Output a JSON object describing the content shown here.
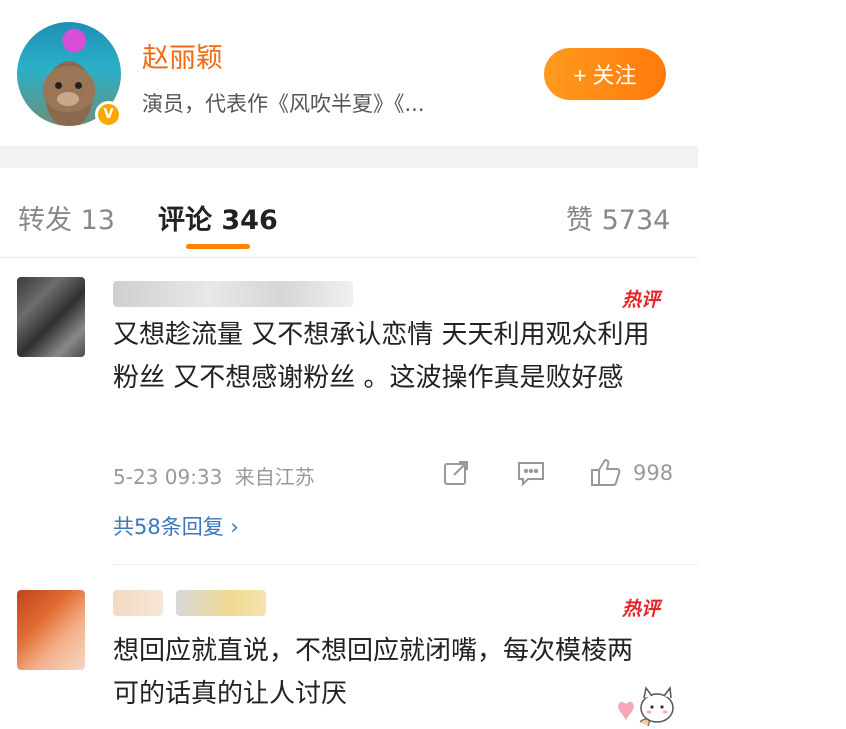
{
  "author": {
    "name": "赵丽颖",
    "description": "演员，代表作《风吹半夏》《...",
    "verified_badge": "V",
    "follow_label": "+ 关注",
    "accent": "#ff8200"
  },
  "tabs": [
    {
      "label": "转发 13",
      "active": false
    },
    {
      "label": "评论 346",
      "active": true
    },
    {
      "label": "赞 5734",
      "active": false
    }
  ],
  "comments": [
    {
      "hot_tag": "热评",
      "text": "又想趁流量 又不想承认恋情 天天利用观众利用粉丝 又不想感谢粉丝 。这波操作真是败好感",
      "time": "5-23 09:33",
      "location": "来自江苏",
      "likes": "998",
      "replies": "共58条回复 ›",
      "icons": [
        "share-icon",
        "comment-icon",
        "like-icon"
      ]
    },
    {
      "hot_tag": "热评",
      "text": "想回应就直说，不想回应就闭嘴，每次模棱两可的话真的让人讨厌"
    }
  ],
  "colors": {
    "name_orange": "#f06b12",
    "hot_red": "#e6262c",
    "link_blue": "#3a77bf",
    "meta_gray": "#999999"
  }
}
